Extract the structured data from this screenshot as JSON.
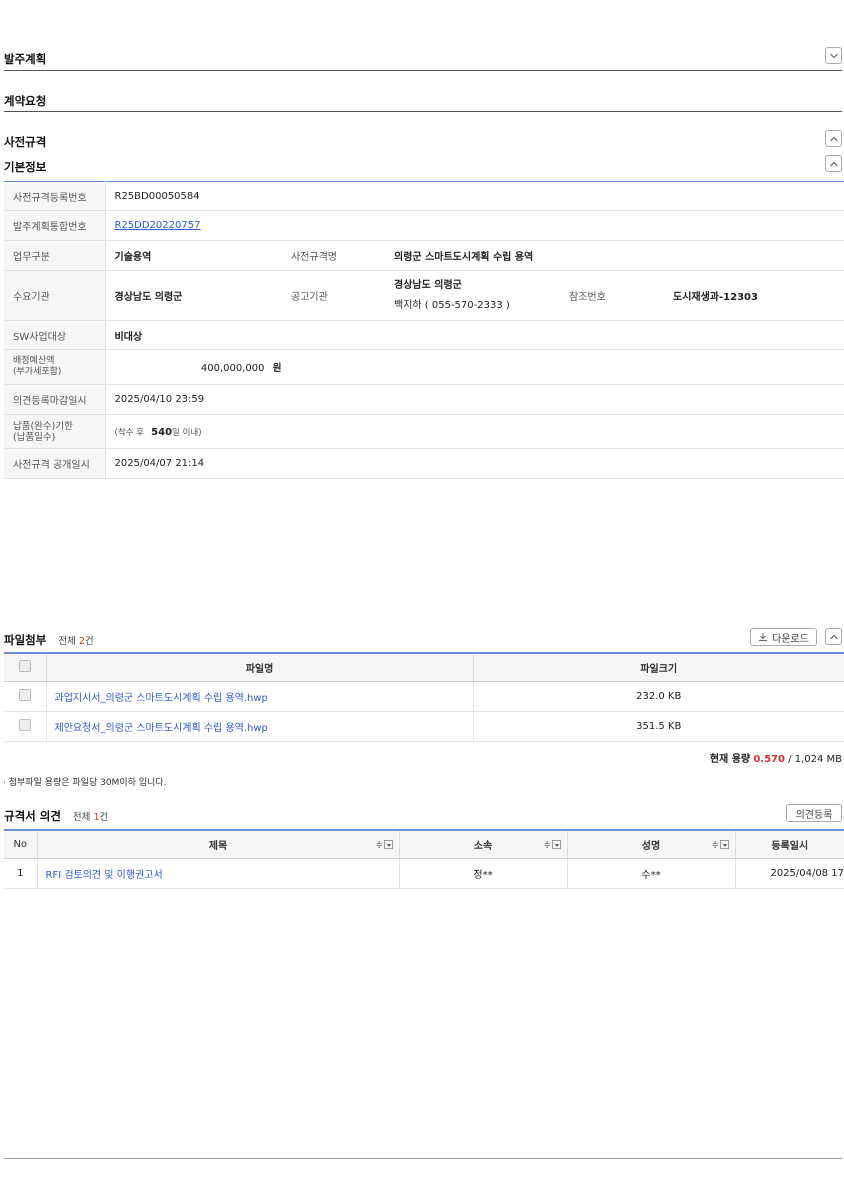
{
  "sections": {
    "order_plan": "발주계획",
    "contract_request": "계약요청",
    "pre_spec": "사전규격",
    "basic_info": "기본정보"
  },
  "info": {
    "reg_no_label": "사전규격등록번호",
    "reg_no": "R25BD00050584",
    "plan_no_label": "발주계획통합번호",
    "plan_no": "R25DD20220757",
    "biz_type_label": "업무구분",
    "biz_type": "기술용역",
    "spec_name_label": "사전규격명",
    "spec_name": "의령군 스마트도시계획 수립 용역",
    "demand_org_label": "수요기관",
    "demand_org": "경상남도 의령군",
    "notice_org_label": "공고기관",
    "notice_org": "경상남도 의령군",
    "notice_contact": "백지하 ( 055-570-2333 )",
    "ref_no_label": "참조번호",
    "ref_no": "도시재생과-12303",
    "sw_label": "SW사업대상",
    "sw": "비대상",
    "budget_label_1": "배정예산액",
    "budget_label_2": "(부가세포함)",
    "budget": "400,000,000",
    "budget_unit": "원",
    "deadline_label": "의견등록마감일시",
    "deadline": "2025/04/10 23:59",
    "delivery_label_1": "납품(완수)기한",
    "delivery_label_2": "(납품일수)",
    "delivery_prefix": "(착수 후",
    "delivery_days": "540",
    "delivery_suffix": "일 이내)",
    "open_label": "사전규격 공개일시",
    "open": "2025/04/07 21:14"
  },
  "files": {
    "title": "파일첨부",
    "total_prefix": "전체",
    "total_count": "2",
    "total_suffix": "건",
    "download_label": "다운로드",
    "col_name": "파일명",
    "col_size": "파일크기",
    "rows": [
      {
        "name": "과업지시서_의령군 스마트도시계획 수립 용역.hwp",
        "size": "232.0 KB"
      },
      {
        "name": "제안요청서_의령군 스마트도시계획 수립 용역.hwp",
        "size": "351.5 KB"
      }
    ],
    "usage_label": "현재 용량",
    "usage_current": "0.570",
    "usage_total": "/ 1,024 MB",
    "note": "· 첨부파일 용량은 파일당 30M이하 입니다."
  },
  "opinions": {
    "title": "규격서 의견",
    "total_prefix": "전체",
    "total_count": "1",
    "total_suffix": "건",
    "register_label": "의견등록",
    "col_no": "No",
    "col_title": "제목",
    "col_affil": "소속",
    "col_name": "성명",
    "col_date": "등록일시",
    "rows": [
      {
        "no": "1",
        "title": "RFI 검토의견 및 이행권고서",
        "affil": "정**",
        "name": "수**",
        "date": "2025/04/08 17"
      }
    ]
  },
  "colors": {
    "accent_blue": "#2a5bd7",
    "header_line": "#6a8fd6",
    "highlight_red": "#e0302a"
  }
}
